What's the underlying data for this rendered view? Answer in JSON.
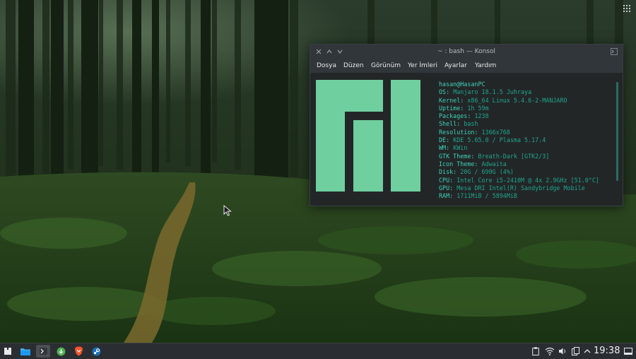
{
  "konsole": {
    "title": "~ : bash — Konsol",
    "menu": [
      "Dosya",
      "Düzen",
      "Görünüm",
      "Yer İmleri",
      "Ayarlar",
      "Yardım"
    ],
    "neofetch": {
      "header": "hasan@HasanPC",
      "lines": [
        {
          "key": "OS",
          "value": "Manjaro 18.1.5 Juhraya"
        },
        {
          "key": "Kernel",
          "value": "x86_64 Linux 5.4.6-2-MANJARO"
        },
        {
          "key": "Uptime",
          "value": "1h 59m"
        },
        {
          "key": "Packages",
          "value": "1238"
        },
        {
          "key": "Shell",
          "value": "bash"
        },
        {
          "key": "Resolution",
          "value": "1366x768"
        },
        {
          "key": "DE",
          "value": "KDE 5.65.0 / Plasma 5.17.4"
        },
        {
          "key": "WM",
          "value": "KWin"
        },
        {
          "key": "GTK Theme",
          "value": "Breath-Dark [GTK2/3]"
        },
        {
          "key": "Icon Theme",
          "value": "Adwaita"
        },
        {
          "key": "Disk",
          "value": "20G / 690G (4%)"
        },
        {
          "key": "CPU",
          "value": "Intel Core i5-2410M @ 4x 2.9GHz [51.0°C]"
        },
        {
          "key": "GPU",
          "value": "Mesa DRI Intel(R) Sandybridge Mobile"
        },
        {
          "key": "RAM",
          "value": "1711MiB / 5894MiB"
        }
      ]
    },
    "colors": {
      "logo": "#6fcf9f",
      "text": "#1ebfa6"
    }
  },
  "taskbar": {
    "clock": "19:38",
    "launchers": [
      "application-launcher-icon",
      "file-manager-icon",
      "konsole-icon",
      "download-manager-icon",
      "brave-browser-icon",
      "steam-icon"
    ],
    "tray": [
      "clipboard-icon",
      "network-wifi-icon",
      "volume-icon",
      "device-notifier-icon",
      "tray-expand-icon",
      "show-desktop-icon"
    ]
  }
}
